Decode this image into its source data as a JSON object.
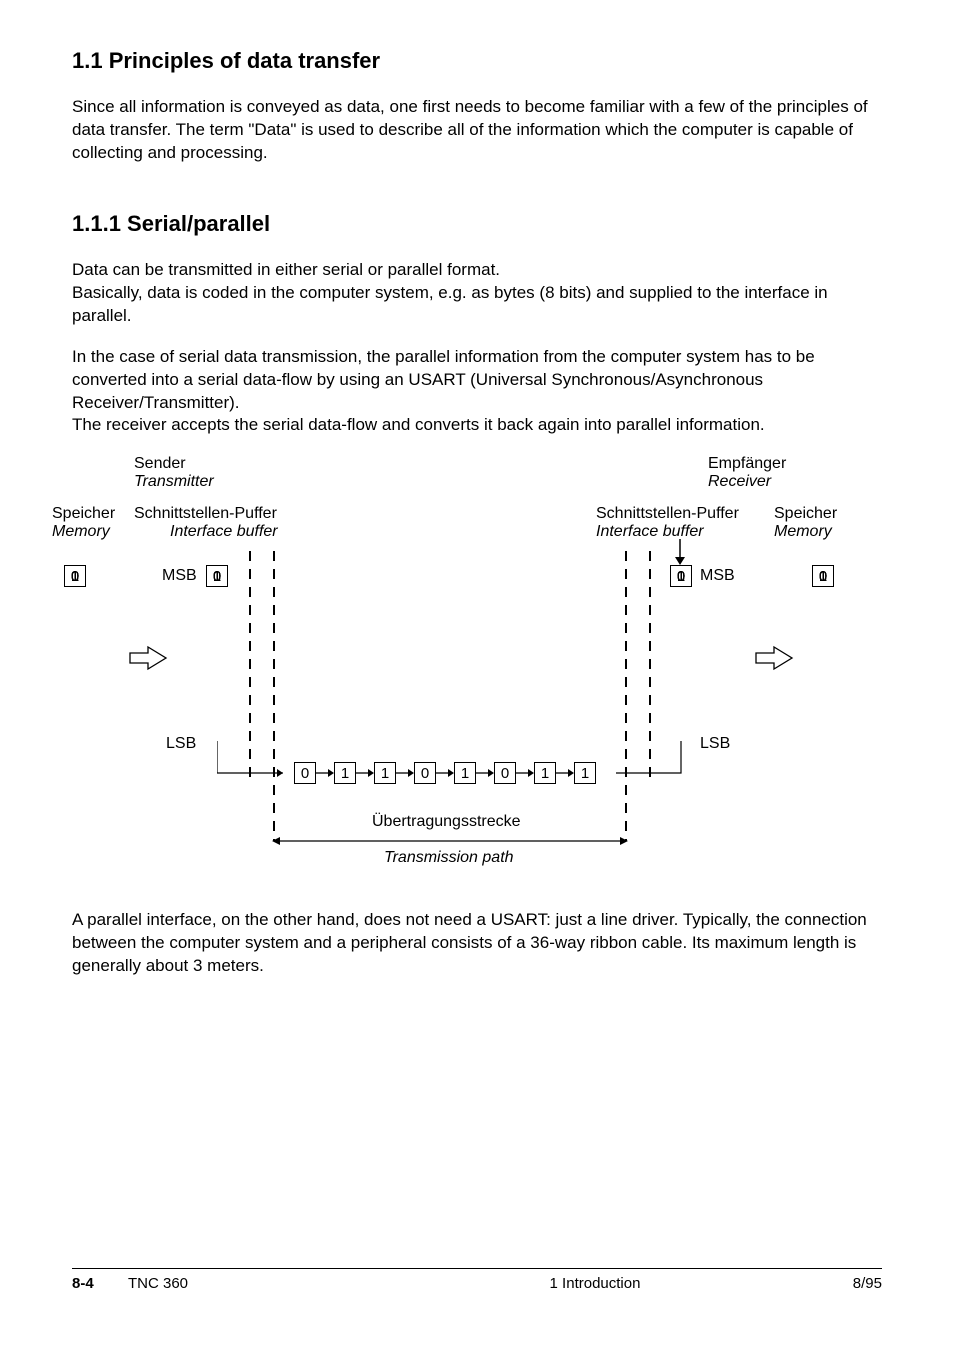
{
  "heading1": "1.1  Principles of data transfer",
  "para1": "Since all information is conveyed as data, one first needs to become familiar with a few of the principles of data transfer. The term \"Data\" is used to describe all of the information which the computer is capable of collecting and processing.",
  "heading2": "1.1.1  Serial/parallel",
  "para2a": "Data can be transmitted in either serial or parallel format.",
  "para2b": "Basically, data is coded in the computer system, e.g. as bytes (8 bits) and supplied to the interface in parallel.",
  "para3a": "In the case of serial data transmission, the parallel information from the computer system has to be converted into a serial data-flow by using an USART (Universal Synchronous/Asynchronous Receiver/Transmitter).",
  "para3b": "The receiver accepts the serial data-flow and converts it back again into parallel information.",
  "para4": "A parallel interface, on the other hand, does not need a USART: just a line driver. Typically, the connection between the computer system and a peripheral consists of a 36-way ribbon cable. Its maximum length is generally about 3 meters.",
  "diagram": {
    "sender_de": "Sender",
    "sender_en": "Transmitter",
    "receiver_de": "Empfänger",
    "receiver_en": "Receiver",
    "memory_de": "Speicher",
    "memory_en": "Memory",
    "buffer_de": "Schnittstellen-Puffer",
    "buffer_en": "Interface buffer",
    "msb": "MSB",
    "lsb": "LSB",
    "path_de": "Übertragungsstrecke",
    "path_en": "Transmission path",
    "byte": [
      "0",
      "1",
      "1",
      "0",
      "1",
      "0",
      "1",
      "1"
    ],
    "serial": [
      "0",
      "1",
      "1",
      "0",
      "1",
      "0",
      "1",
      "1"
    ]
  },
  "footer": {
    "page": "8-4",
    "model": "TNC 360",
    "chapter": "1  Introduction",
    "date": "8/95"
  }
}
